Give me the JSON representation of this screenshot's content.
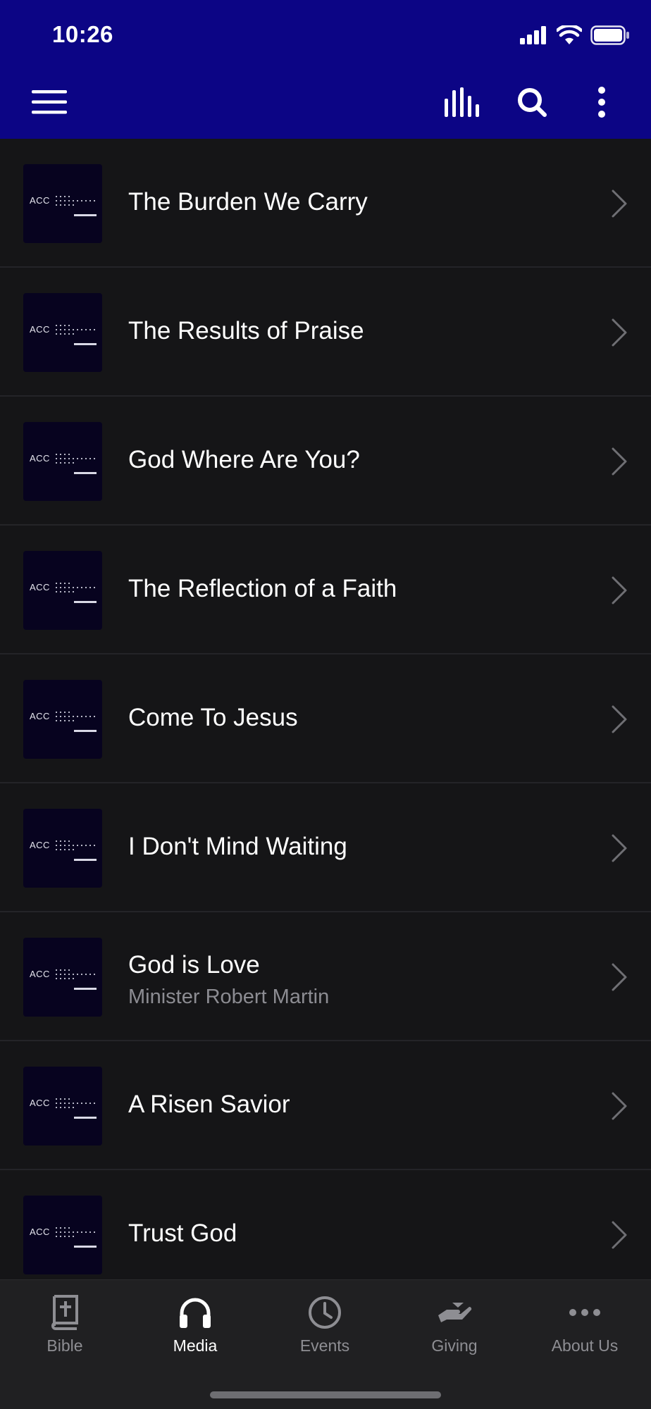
{
  "status_bar": {
    "time": "10:26"
  },
  "toolbar": {
    "menu_icon": "hamburger-menu-icon",
    "now_playing_icon": "audio-bars-icon",
    "search_icon": "search-icon",
    "more_icon": "more-vertical-icon"
  },
  "thumbnail": {
    "text": "ACC"
  },
  "items": [
    {
      "title": "The Burden We Carry",
      "subtitle": ""
    },
    {
      "title": "The Results of Praise",
      "subtitle": ""
    },
    {
      "title": "God Where Are You?",
      "subtitle": ""
    },
    {
      "title": "The Reflection of a Faith",
      "subtitle": ""
    },
    {
      "title": "Come To Jesus",
      "subtitle": ""
    },
    {
      "title": "I Don't Mind Waiting",
      "subtitle": ""
    },
    {
      "title": "God is Love",
      "subtitle": "Minister Robert Martin"
    },
    {
      "title": "A Risen Savior",
      "subtitle": ""
    },
    {
      "title": "Trust God",
      "subtitle": ""
    }
  ],
  "tabs": [
    {
      "label": "Bible",
      "icon": "bible-icon",
      "active": false
    },
    {
      "label": "Media",
      "icon": "headphones-icon",
      "active": true
    },
    {
      "label": "Events",
      "icon": "clock-icon",
      "active": false
    },
    {
      "label": "Giving",
      "icon": "giving-hand-icon",
      "active": false
    },
    {
      "label": "About Us",
      "icon": "more-horizontal-icon",
      "active": false
    }
  ],
  "colors": {
    "header": "#0c0585",
    "background": "#151517",
    "tabbar": "#202022",
    "inactive_tab": "#8e8e93"
  }
}
